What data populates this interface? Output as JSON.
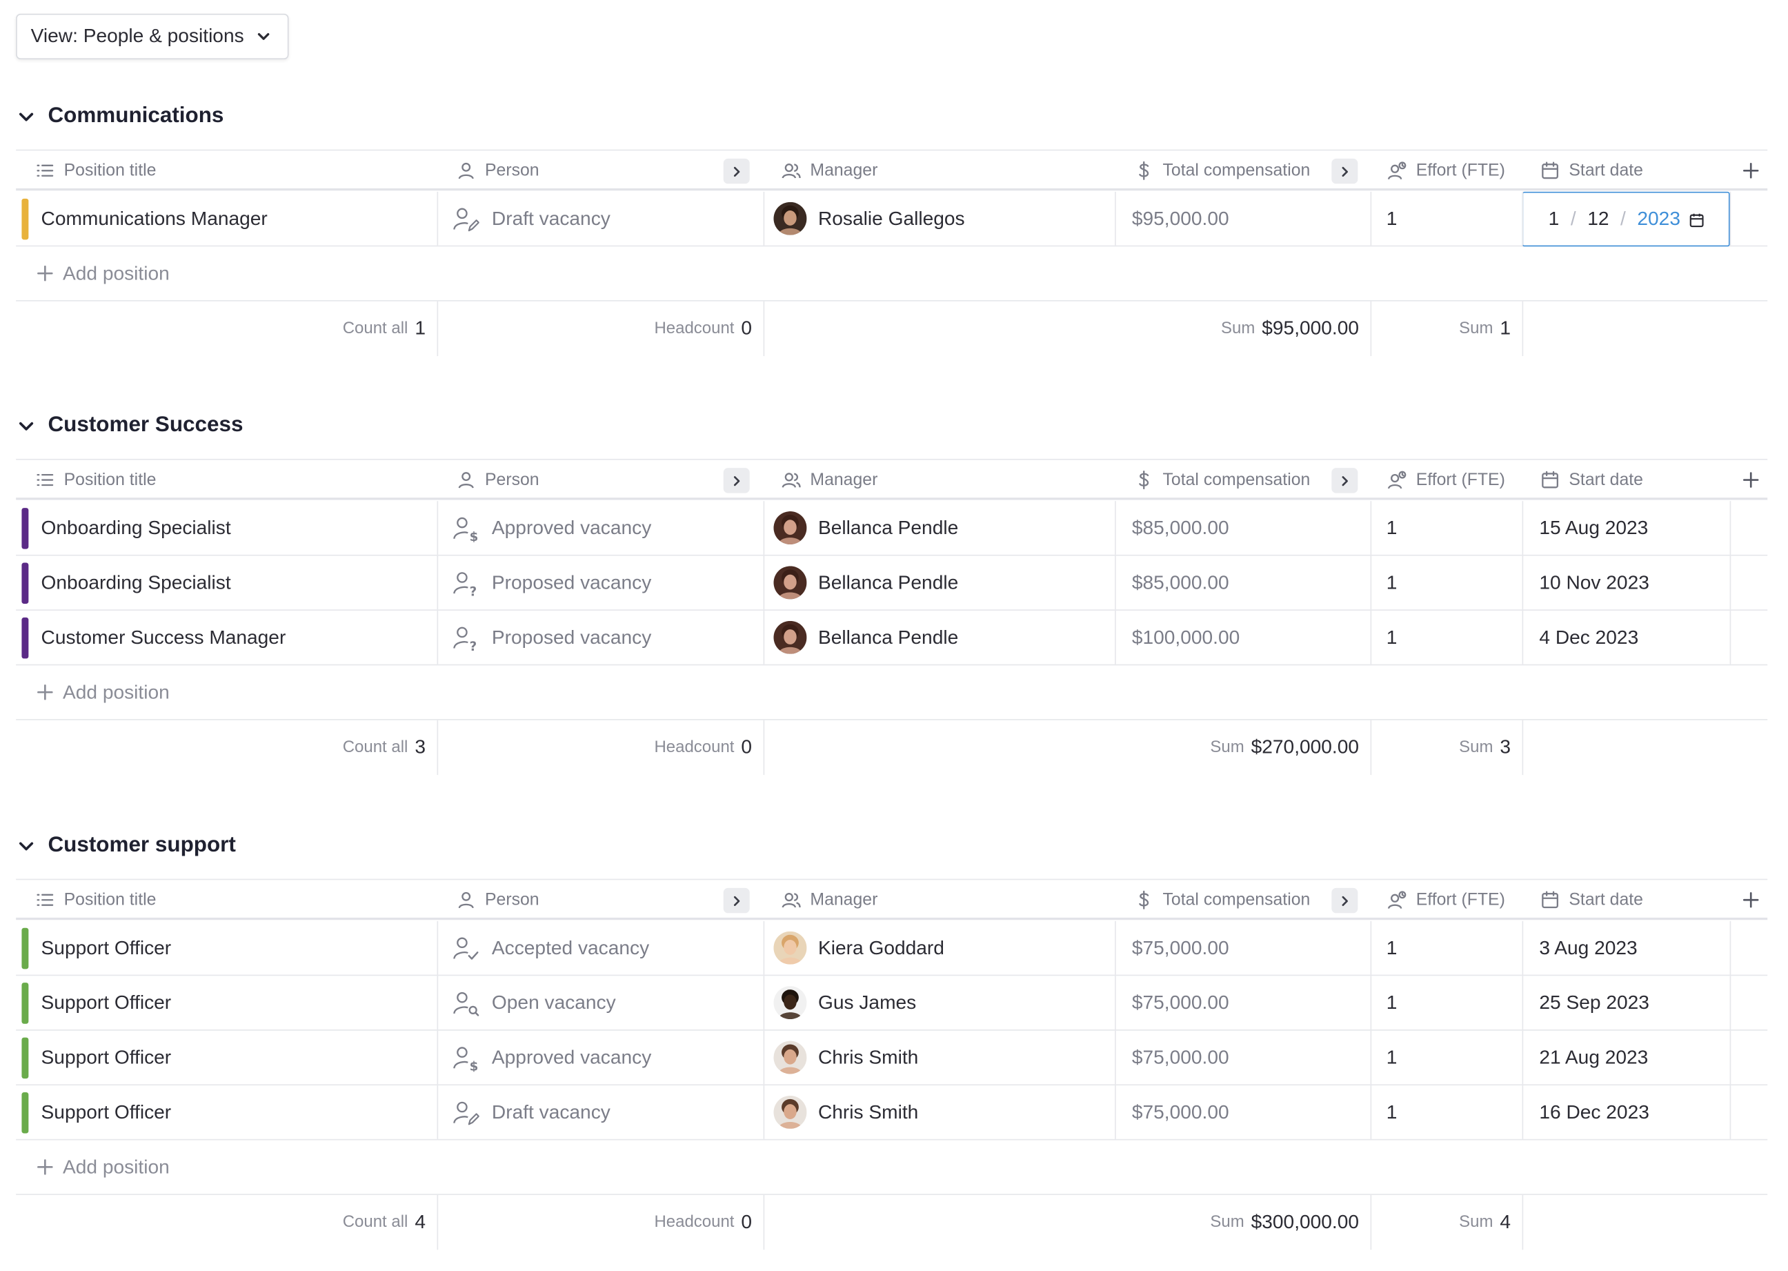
{
  "view_button": {
    "label": "View: People & positions",
    "icon": "chevron-down-icon"
  },
  "columns": {
    "position_title": "Position title",
    "person": "Person",
    "manager": "Manager",
    "total_compensation": "Total compensation",
    "effort": "Effort (FTE)",
    "start_date": "Start date"
  },
  "add_position_label": "Add position",
  "summary_labels": {
    "count": "Count all",
    "headcount": "Headcount",
    "sum": "Sum"
  },
  "colors": {
    "accent_blue": "#3f8fd8",
    "communications": "#e8b23c",
    "customer_success": "#5b2a86",
    "customer_support": "#6aab4b"
  },
  "groups": [
    {
      "name": "Communications",
      "rows": [
        {
          "title": "Communications Manager",
          "status": "Draft vacancy",
          "status_icon": "draft-vacancy-icon",
          "manager": "Rosalie Gallegos",
          "comp": "$95,000.00",
          "effort": "1",
          "start": "",
          "date_edit": {
            "day": "1",
            "month": "12",
            "year": "2023"
          }
        }
      ],
      "summary": {
        "count": "1",
        "headcount": "0",
        "sum_comp": "$95,000.00",
        "sum_effort": "1"
      }
    },
    {
      "name": "Customer Success",
      "rows": [
        {
          "title": "Onboarding Specialist",
          "status": "Approved vacancy",
          "status_icon": "approved-vacancy-icon",
          "manager": "Bellanca Pendle",
          "comp": "$85,000.00",
          "effort": "1",
          "start": "15 Aug 2023"
        },
        {
          "title": "Onboarding Specialist",
          "status": "Proposed vacancy",
          "status_icon": "proposed-vacancy-icon",
          "manager": "Bellanca Pendle",
          "comp": "$85,000.00",
          "effort": "1",
          "start": "10 Nov 2023"
        },
        {
          "title": "Customer Success Manager",
          "status": "Proposed vacancy",
          "status_icon": "proposed-vacancy-icon",
          "manager": "Bellanca Pendle",
          "comp": "$100,000.00",
          "effort": "1",
          "start": "4 Dec 2023"
        }
      ],
      "summary": {
        "count": "3",
        "headcount": "0",
        "sum_comp": "$270,000.00",
        "sum_effort": "3"
      }
    },
    {
      "name": "Customer support",
      "rows": [
        {
          "title": "Support Officer",
          "status": "Accepted vacancy",
          "status_icon": "accepted-vacancy-icon",
          "manager": "Kiera Goddard",
          "comp": "$75,000.00",
          "effort": "1",
          "start": "3 Aug 2023"
        },
        {
          "title": "Support Officer",
          "status": "Open vacancy",
          "status_icon": "open-vacancy-icon",
          "manager": "Gus James",
          "comp": "$75,000.00",
          "effort": "1",
          "start": "25 Sep 2023"
        },
        {
          "title": "Support Officer",
          "status": "Approved vacancy",
          "status_icon": "approved-vacancy-icon",
          "manager": "Chris Smith",
          "comp": "$75,000.00",
          "effort": "1",
          "start": "21 Aug 2023"
        },
        {
          "title": "Support Officer",
          "status": "Draft vacancy",
          "status_icon": "draft-vacancy-icon",
          "manager": "Chris Smith",
          "comp": "$75,000.00",
          "effort": "1",
          "start": "16 Dec 2023"
        }
      ],
      "summary": {
        "count": "4",
        "headcount": "0",
        "sum_comp": "$300,000.00",
        "sum_effort": "4"
      }
    }
  ]
}
